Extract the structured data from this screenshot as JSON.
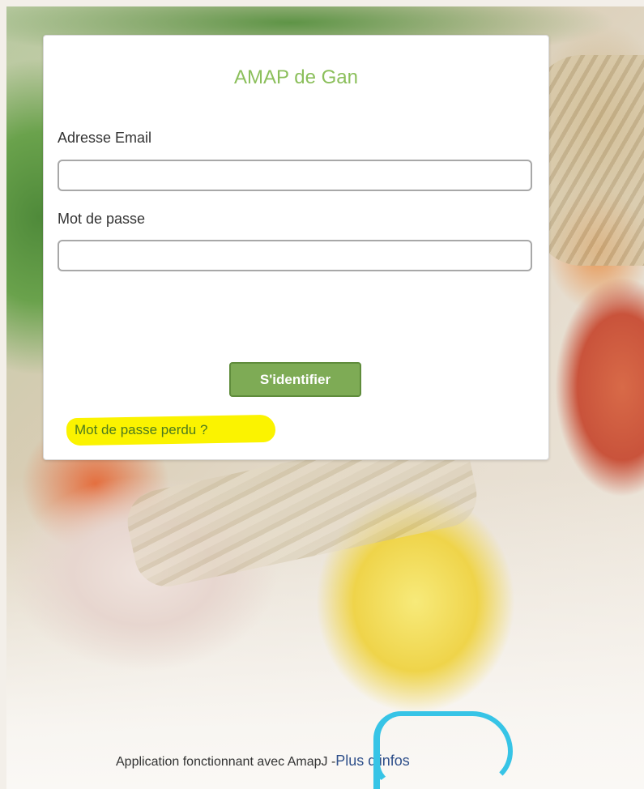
{
  "card": {
    "title": "AMAP de Gan",
    "email_label": "Adresse Email",
    "email_value": "",
    "password_label": "Mot de passe",
    "password_value": "",
    "login_button": "S'identifier",
    "forgot_link": "Mot de passe perdu ?"
  },
  "footer": {
    "text": "Application fonctionnant avec AmapJ -",
    "more_link": "Plus d'infos"
  },
  "colors": {
    "title": "#8bbf5b",
    "button": "#7eab55",
    "highlight": "#fbf300",
    "annotation_circle": "#37c4e6",
    "link": "#2e4f8a"
  }
}
